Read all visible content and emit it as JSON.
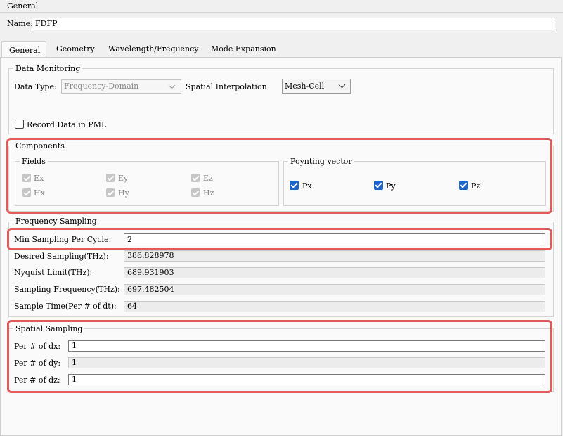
{
  "header": {
    "section_label": "General",
    "name_label": "Name:",
    "name_value": "FDFP"
  },
  "tabs": [
    "General",
    "Geometry",
    "Wavelength/Frequency",
    "Mode Expansion"
  ],
  "data_monitoring": {
    "title": "Data Monitoring",
    "data_type_label": "Data Type:",
    "data_type_value": "Frequency-Domain",
    "spatial_interp_label": "Spatial Interpolation:",
    "spatial_interp_value": "Mesh-Cell",
    "record_pml_label": "Record Data in PML"
  },
  "components": {
    "title": "Components",
    "fields_title": "Fields",
    "fields": [
      "Ex",
      "Ey",
      "Ez",
      "Hx",
      "Hy",
      "Hz"
    ],
    "poynting_title": "Poynting vector",
    "poynting": [
      "Px",
      "Py",
      "Pz"
    ]
  },
  "frequency_sampling": {
    "title": "Frequency Sampling",
    "min_label": "Min Sampling Per Cycle:",
    "min_value": "2",
    "desired_label": "Desired Sampling(THz):",
    "desired_value": "386.828978",
    "nyquist_label": "Nyquist Limit(THz):",
    "nyquist_value": "689.931903",
    "sampfreq_label": "Sampling Frequency(THz):",
    "sampfreq_value": "697.482504",
    "sampletime_label": "Sample Time(Per # of dt):",
    "sampletime_value": "64"
  },
  "spatial_sampling": {
    "title": "Spatial Sampling",
    "dx_label": "Per # of dx:",
    "dx_value": "1",
    "dy_label": "Per # of dy:",
    "dy_value": "1",
    "dz_label": "Per # of dz:",
    "dz_value": "1"
  },
  "colors": {
    "highlight": "#e35a5a",
    "checkbox": "#1e63c8"
  }
}
